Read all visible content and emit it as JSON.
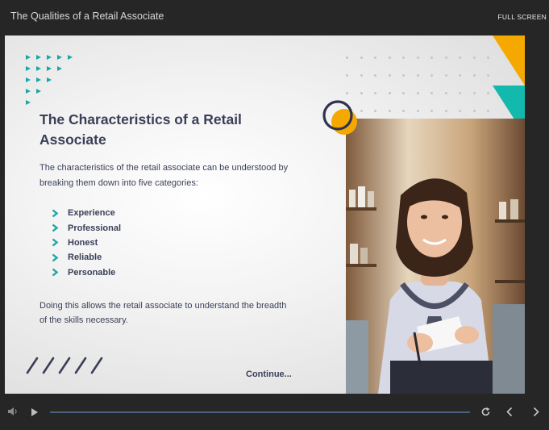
{
  "window": {
    "course_title": "The Qualities of a Retail Associate",
    "fullscreen_label": "FULL SCREEN"
  },
  "slide": {
    "heading": "The Characteristics of a Retail Associate",
    "intro": "The characteristics of the retail associate can be understood by breaking them down into five categories:",
    "bullets": [
      "Experience",
      "Professional",
      "Honest",
      "Reliable",
      "Personable"
    ],
    "outro": "Doing this allows the retail associate to understand the breadth of the skills necessary.",
    "continue_label": "Continue...",
    "accent_teal": "#1aa6a6",
    "accent_orange": "#f5a800",
    "text_color": "#3a3f58"
  },
  "player": {
    "icons": [
      "volume-icon",
      "play-icon",
      "replay-icon",
      "previous-icon",
      "next-icon"
    ],
    "progress": 0,
    "track_color": "#4c6080"
  }
}
